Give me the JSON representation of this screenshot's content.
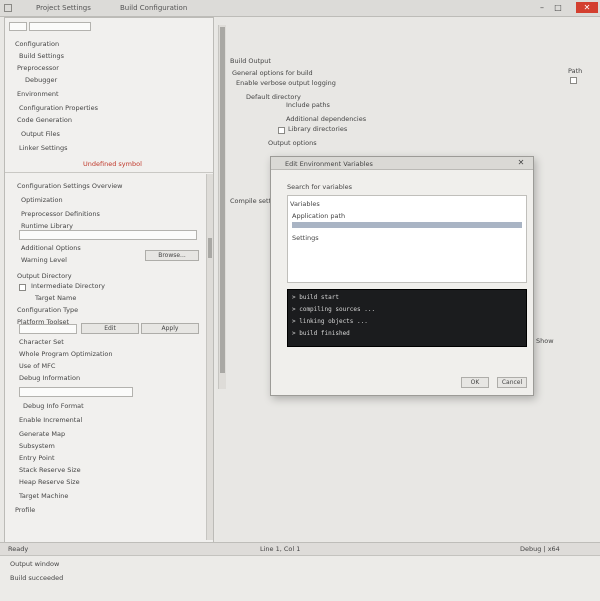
{
  "colors": {
    "window_bg": "#e9e8e5",
    "close_button": "#d33f2f",
    "console_bg": "#1b1c1e",
    "warning_text": "#c0392b"
  },
  "icons": [
    "folder-icon",
    "close-icon",
    "minimize-icon",
    "maximize-icon",
    "chevron-down-icon",
    "checkbox-icon"
  ],
  "titlebar": {
    "tab_label": "Project Settings",
    "doc_path": "Build Configuration",
    "minimize": "–",
    "maximize": "□",
    "close": "✕"
  },
  "left_panel": {
    "tree": [
      "Configuration",
      "Build Settings",
      "Preprocessor",
      "Debugger",
      "Environment",
      "Configuration Properties",
      "Code Generation",
      "Output Files",
      "Linker Settings"
    ],
    "tree_warning": "Undefined symbol",
    "section_header": "Configuration Settings Overview",
    "props": [
      "Optimization",
      "Preprocessor Definitions",
      "Runtime Library",
      "Additional Options",
      "Warning Level"
    ],
    "browse_button": "Browse...",
    "lower_items": [
      "Output Directory",
      "Intermediate Directory",
      "Target Name",
      "Configuration Type",
      "Platform Toolset"
    ],
    "edit_button": "Edit",
    "apply_button": "Apply",
    "list_items": [
      "Character Set",
      "Whole Program Optimization",
      "Use of MFC",
      "Debug Information",
      "Debug Info Format",
      "Enable Incremental",
      "Generate Map",
      "Subsystem",
      "Entry Point",
      "Stack Reserve Size",
      "Heap Reserve Size",
      "Target Machine",
      "Profile"
    ]
  },
  "main": {
    "header": "Build Output",
    "lines": [
      "General options for build",
      "Enable verbose output logging",
      "Default directory",
      "Include paths",
      "Additional dependencies",
      "Library directories",
      "Output options",
      "Compile settings"
    ],
    "side_label_1": "Path",
    "side_label_2": "Show"
  },
  "dialog": {
    "title": "Edit Environment Variables",
    "subtitle": "Search for variables",
    "section_label": "Variables",
    "entry_selected": "Application path",
    "entry_2": "Settings",
    "console_lines": [
      "> build start",
      "> compiling sources ...",
      "> linking objects ...",
      "> build finished"
    ],
    "ok": "OK",
    "cancel": "Cancel"
  },
  "status_bar": {
    "left": "Ready",
    "middle": "Line 1, Col 1",
    "right": "Debug | x64"
  },
  "bottom": {
    "line1": "Output window",
    "line2": "Build succeeded"
  }
}
